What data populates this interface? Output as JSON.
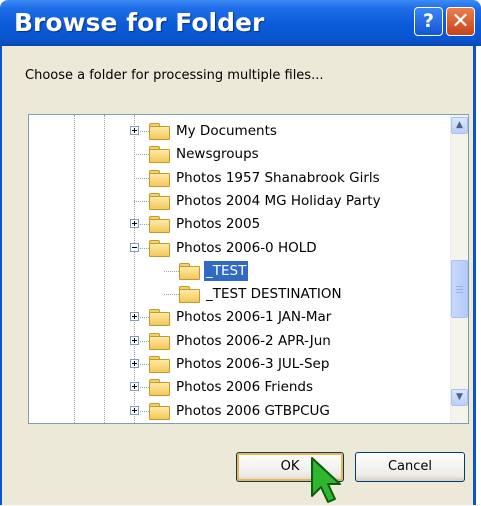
{
  "window": {
    "title": "Browse for Folder",
    "help_glyph": "?",
    "close_glyph": "✕"
  },
  "prompt": "Choose a folder for processing multiple files...",
  "tree": {
    "items": [
      {
        "label": "My Documents",
        "expander": "plus",
        "selected": false,
        "level": 0
      },
      {
        "label": "Newsgroups",
        "expander": "none",
        "selected": false,
        "level": 0
      },
      {
        "label": "Photos 1957 Shanabrook Girls",
        "expander": "none",
        "selected": false,
        "level": 0
      },
      {
        "label": "Photos 2004 MG Holiday Party",
        "expander": "none",
        "selected": false,
        "level": 0
      },
      {
        "label": "Photos 2005",
        "expander": "plus",
        "selected": false,
        "level": 0
      },
      {
        "label": "Photos 2006-0 HOLD",
        "expander": "minus",
        "selected": false,
        "level": 0
      },
      {
        "label": "_TEST",
        "expander": "none",
        "selected": true,
        "level": 1
      },
      {
        "label": "_TEST DESTINATION",
        "expander": "none",
        "selected": false,
        "level": 1
      },
      {
        "label": "Photos 2006-1 JAN-Mar",
        "expander": "plus",
        "selected": false,
        "level": 0
      },
      {
        "label": "Photos 2006-2 APR-Jun",
        "expander": "plus",
        "selected": false,
        "level": 0
      },
      {
        "label": "Photos 2006-3 JUL-Sep",
        "expander": "plus",
        "selected": false,
        "level": 0
      },
      {
        "label": "Photos 2006 Friends",
        "expander": "plus",
        "selected": false,
        "level": 0
      },
      {
        "label": "Photos 2006 GTBPCUG",
        "expander": "plus",
        "selected": false,
        "level": 0
      }
    ]
  },
  "buttons": {
    "ok": "OK",
    "cancel": "Cancel"
  },
  "colors": {
    "title_bar": "#0a55cf",
    "selection": "#316ac5",
    "dialog_bg": "#ece9d8",
    "cursor": "#2fb52f"
  }
}
